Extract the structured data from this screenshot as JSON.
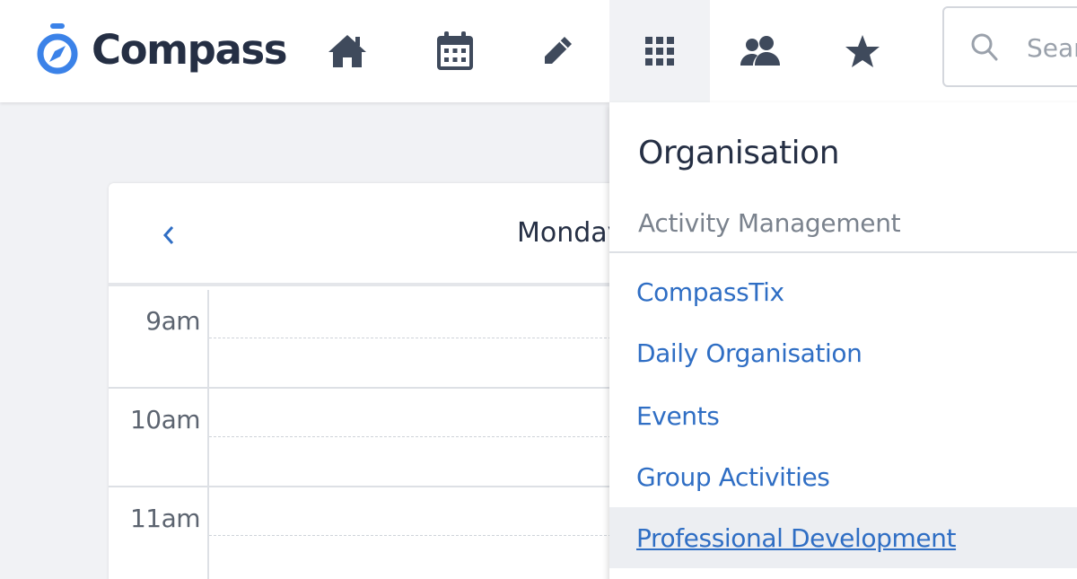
{
  "brand": {
    "name": "Compass",
    "icon": "compass-logo-icon",
    "color": "#3b82e8"
  },
  "nav": {
    "items": [
      {
        "id": "home",
        "icon": "home-icon"
      },
      {
        "id": "calendar",
        "icon": "calendar-icon"
      },
      {
        "id": "edit",
        "icon": "pencil-icon"
      },
      {
        "id": "apps",
        "icon": "grid-icon",
        "active": true
      },
      {
        "id": "people",
        "icon": "people-icon"
      },
      {
        "id": "favourites",
        "icon": "star-icon"
      }
    ]
  },
  "search": {
    "placeholder": "Search",
    "icon": "search-icon"
  },
  "calendar": {
    "prev_icon": "chevron-left-icon",
    "day_title": "Monday",
    "slots": [
      "9am",
      "10am",
      "11am"
    ]
  },
  "dropdown": {
    "heading": "Organisation",
    "section": "Activity Management",
    "items": [
      {
        "label": "CompassTix"
      },
      {
        "label": "Daily Organisation"
      },
      {
        "label": "Events"
      },
      {
        "label": "Group Activities"
      },
      {
        "label": "Professional Development",
        "hovered": true
      }
    ]
  },
  "colors": {
    "link": "#2f6ec4",
    "icon": "#3f4a5c",
    "background": "#f1f2f5"
  }
}
